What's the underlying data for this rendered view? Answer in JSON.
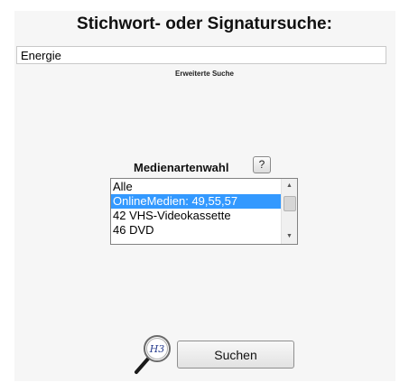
{
  "header": {
    "title": "Stichwort- oder Signatursuche:"
  },
  "search": {
    "value": "Energie"
  },
  "advanced_search": {
    "label": "Erweiterte Suche"
  },
  "media_type": {
    "label": "Medienartenwahl",
    "help_label": "?",
    "options": [
      "Alle",
      "OnlineMedien: 49,55,57",
      "42 VHS-Videokassette",
      "46 DVD"
    ],
    "selected": "OnlineMedien: 49,55,57"
  },
  "logo": {
    "text": "H3"
  },
  "actions": {
    "search_label": "Suchen"
  },
  "colors": {
    "selection": "#3399ff",
    "panel": "#f6f6f6"
  },
  "icons": {
    "logo": "magnifier-icon",
    "scroll_up": "scroll-up-arrow-icon",
    "scroll_down": "scroll-down-arrow-icon"
  }
}
